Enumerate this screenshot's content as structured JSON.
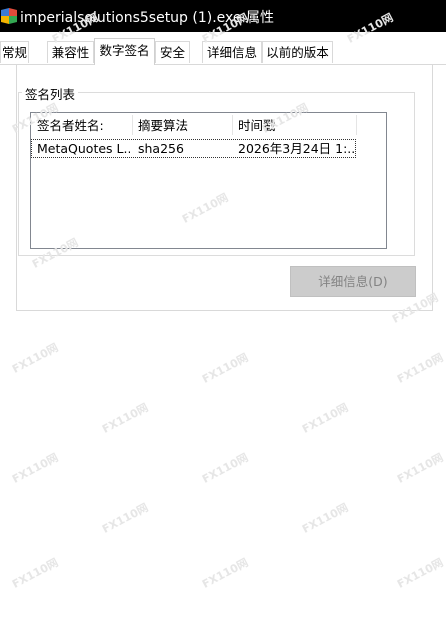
{
  "window": {
    "title": "imperialsolutions5setup (1).exe 属性"
  },
  "tabs": [
    {
      "label": "常规"
    },
    {
      "label": "兼容性"
    },
    {
      "label": "数字签名",
      "active": true
    },
    {
      "label": "安全"
    },
    {
      "label": "详细信息"
    },
    {
      "label": "以前的版本"
    }
  ],
  "signature_list": {
    "title": "签名列表",
    "columns": [
      "签名者姓名:",
      "摘要算法",
      "时间戳"
    ],
    "rows": [
      [
        "MetaQuotes L...",
        "sha256",
        "2026年3月24日 1:..."
      ]
    ]
  },
  "details_button": {
    "label": "详细信息(D)",
    "enabled": false
  },
  "watermark": "FX110网",
  "colors": {
    "titlebar_bg": "#000000",
    "titlebar_text": "#ffffff",
    "disabled_button_bg": "#cccccc",
    "disabled_button_text": "#838383"
  }
}
